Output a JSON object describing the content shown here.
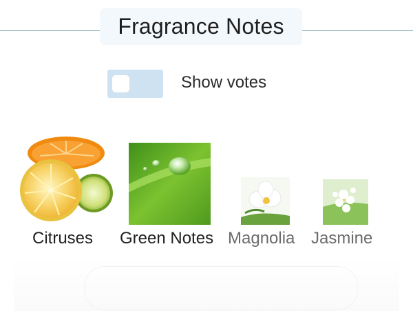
{
  "header": {
    "title": "Fragrance Notes"
  },
  "toggle": {
    "label": "Show votes",
    "checked": false,
    "track_color": "#cfe2f1"
  },
  "notes": [
    {
      "label": "Citruses",
      "icon": "citrus-fruit-image",
      "emphasis": "strong"
    },
    {
      "label": "Green Notes",
      "icon": "green-leaf-dewdrop-image",
      "emphasis": "strong"
    },
    {
      "label": "Magnolia",
      "icon": "magnolia-flower-image",
      "emphasis": "weak"
    },
    {
      "label": "Jasmine",
      "icon": "jasmine-flower-image",
      "emphasis": "weak"
    }
  ]
}
